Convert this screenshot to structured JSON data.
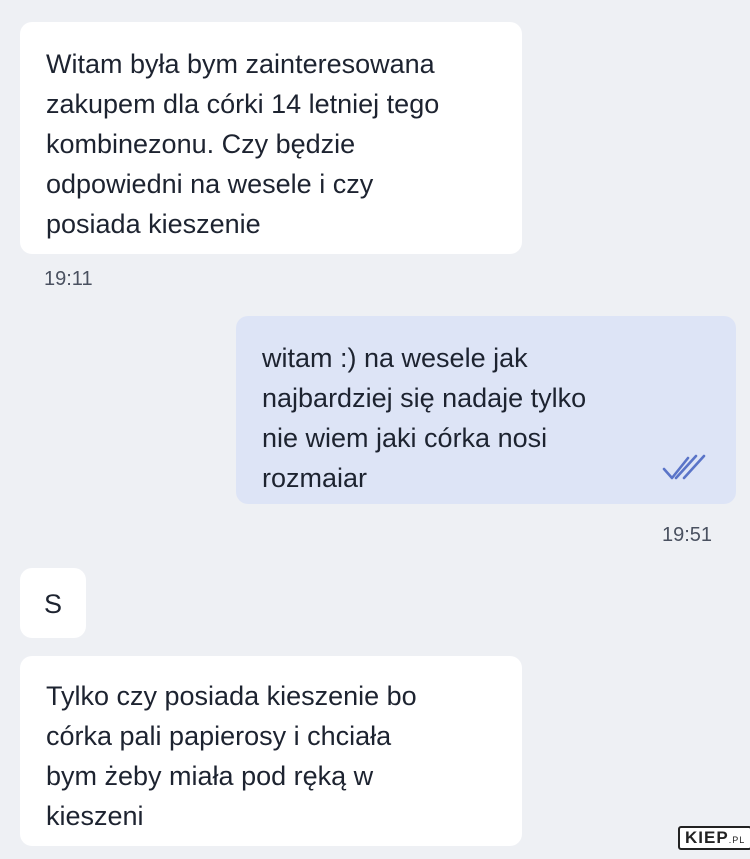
{
  "conversation": {
    "messages": [
      {
        "direction": "incoming",
        "text": "Witam była bym zainteresowana\nzakupem dla córki 14 letniej tego\nkombinezonu. Czy będzie\nodpowiedni na wesele i czy\nposiada kieszenie",
        "time": "19:11"
      },
      {
        "direction": "outgoing",
        "text": "witam :) na wesele jak\nnajbardziej się nadaje tylko\nnie wiem jaki córka nosi\nrozmaiar",
        "time": "19:51",
        "status_icon": "double-check-icon"
      },
      {
        "direction": "incoming",
        "text": "S"
      },
      {
        "direction": "incoming",
        "text": "Tylko czy posiada kieszenie bo\ncórka pali papierosy i chciała\nbym żeby miała pod ręką w\nkieszeni"
      }
    ]
  },
  "watermark": {
    "main": "KIEP",
    "suffix": ".PL"
  },
  "colors": {
    "background": "#eef0f4",
    "incoming_bubble": "#ffffff",
    "outgoing_bubble": "#dde4f6",
    "check_icon": "#5a74c8"
  }
}
